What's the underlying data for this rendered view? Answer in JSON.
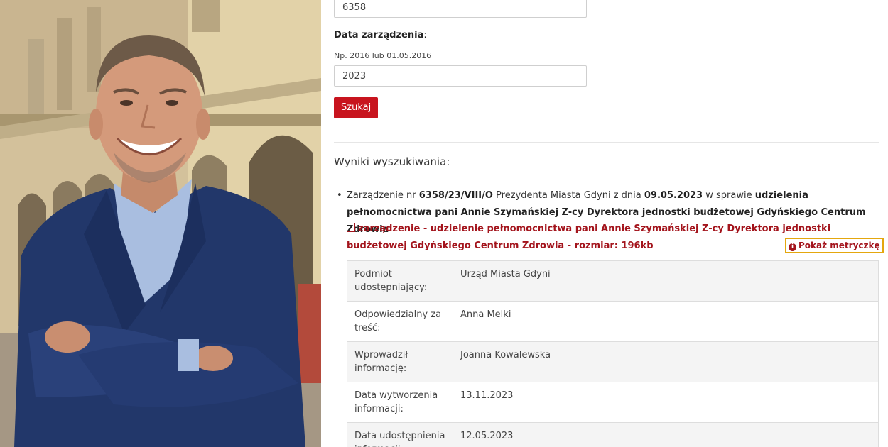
{
  "form": {
    "number_value": "6358",
    "date_label": "Data zarządzenia",
    "date_colon": ":",
    "date_hint": "Np. 2016 lub 01.05.2016",
    "date_value": "2023",
    "search_button": "Szukaj"
  },
  "results": {
    "title": "Wyniki wyszukiwania:",
    "item": {
      "prefix": "Zarządzenie nr ",
      "number": "6358/23/VIII/O",
      "mid": " Prezydenta Miasta Gdyni z dnia ",
      "date": "09.05.2023",
      "in_matter": " w sprawie ",
      "subject": "udzielenia pełnomocnictwa pani Annie Szymańskiej Z-cy Dyrektora jednostki budżetowej Gdyńskiego Centrum Zdrowia",
      "pdf_link": "zarządzenie - udzielenie pełnomocnictwa pani Annie Szymańskiej Z-cy Dyrektora jednostki budżetowej Gdyńskiego Centrum Zdrowia - rozmiar: 196kb",
      "show_meta": "Pokaż metryczkę"
    },
    "meta_rows": [
      {
        "key": "Podmiot udostępniający:",
        "value": "Urząd Miasta Gdyni"
      },
      {
        "key": "Odpowiedzialny za treść:",
        "value": "Anna Melki"
      },
      {
        "key": "Wprowadził informację:",
        "value": "Joanna Kowalewska"
      },
      {
        "key": "Data wytworzenia informacji:",
        "value": "13.11.2023"
      },
      {
        "key": "Data udostępnienia informacji:",
        "value": "12.05.2023"
      }
    ]
  },
  "colors": {
    "accent_red": "#c8141e",
    "link_red": "#a3141c",
    "highlight_border": "#e4a70e"
  },
  "icons": [
    "pdf-icon",
    "info-icon"
  ]
}
